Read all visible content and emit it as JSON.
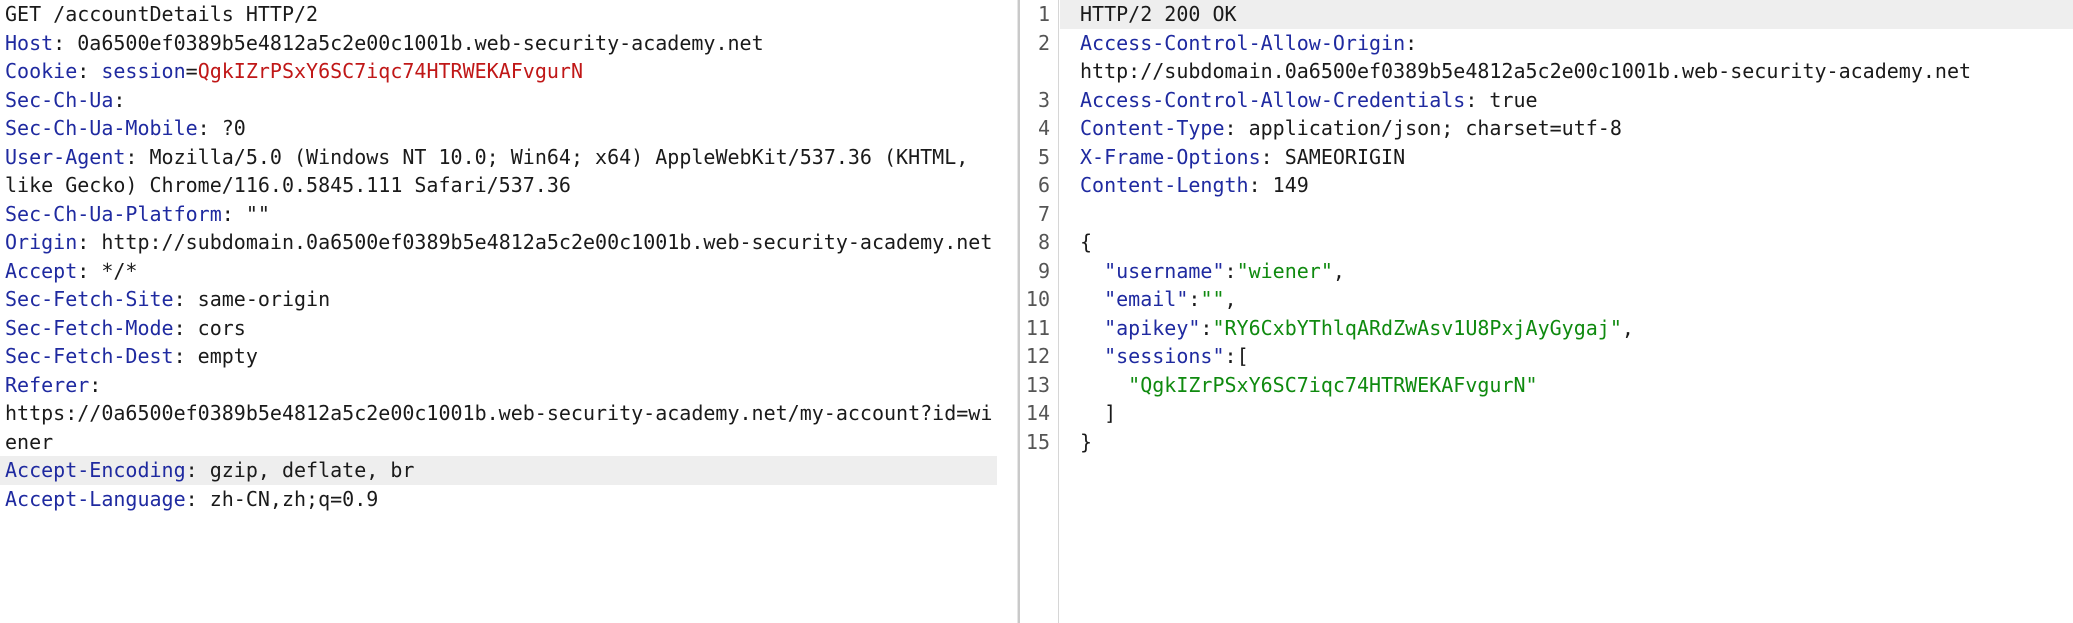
{
  "request": {
    "request_line": "GET /accountDetails HTTP/2",
    "headers": [
      {
        "name": "Host",
        "value": "0a6500ef0389b5e4812a5c2e00c1001b.web-security-academy.net"
      },
      {
        "name": "Cookie",
        "cookie_name": "session",
        "cookie_value": "QgkIZrPSxY6SC7iqc74HTRWEKAFvgurN"
      },
      {
        "name": "Sec-Ch-Ua",
        "value": ""
      },
      {
        "name": "Sec-Ch-Ua-Mobile",
        "value": "?0"
      },
      {
        "name": "User-Agent",
        "value": "Mozilla/5.0 (Windows NT 10.0; Win64; x64) AppleWebKit/537.36 (KHTML,",
        "continuation": "like Gecko) Chrome/116.0.5845.111 Safari/537.36"
      },
      {
        "name": "Sec-Ch-Ua-Platform",
        "value": "\"\""
      },
      {
        "name": "Origin",
        "value": "http://subdomain.0a6500ef0389b5e4812a5c2e00c1001b.web-security-academy.net"
      },
      {
        "name": "Accept",
        "value": "*/*"
      },
      {
        "name": "Sec-Fetch-Site",
        "value": "same-origin"
      },
      {
        "name": "Sec-Fetch-Mode",
        "value": "cors"
      },
      {
        "name": "Sec-Fetch-Dest",
        "value": "empty"
      },
      {
        "name": "Referer",
        "value": "",
        "continuation": "https://0a6500ef0389b5e4812a5c2e00c1001b.web-security-academy.net/my-account?id=wi",
        "continuation2": "ener"
      },
      {
        "name": "Accept-Encoding",
        "value": "gzip, deflate, br"
      },
      {
        "name": "Accept-Language",
        "value": "zh-CN,zh;q=0.9"
      }
    ]
  },
  "response": {
    "line_numbers": [
      "1",
      "2",
      "3",
      "4",
      "5",
      "6",
      "7",
      "8",
      "9",
      "10",
      "11",
      "12",
      "13",
      "14",
      "15"
    ],
    "status_line": "HTTP/2 200 OK",
    "headers": [
      {
        "name": "Access-Control-Allow-Origin",
        "value": "",
        "continuation": "http://subdomain.0a6500ef0389b5e4812a5c2e00c1001b.web-security-academy.net"
      },
      {
        "name": "Access-Control-Allow-Credentials",
        "value": "true"
      },
      {
        "name": "Content-Type",
        "value": "application/json; charset=utf-8"
      },
      {
        "name": "X-Frame-Options",
        "value": "SAMEORIGIN"
      },
      {
        "name": "Content-Length",
        "value": "149"
      }
    ],
    "body": {
      "open_brace": "{",
      "username_key": "\"username\"",
      "username_val": "\"wiener\"",
      "email_key": "\"email\"",
      "email_val": "\"\"",
      "apikey_key": "\"apikey\"",
      "apikey_val": "\"RY6CxbYThlqARdZwAsv1U8PxjAyGygaj\"",
      "sessions_key": "\"sessions\"",
      "sessions_open": "[",
      "sessions_item": "\"QgkIZrPSxY6SC7iqc74HTRWEKAFvgurN\"",
      "sessions_close": "]",
      "close_brace": "}"
    }
  }
}
